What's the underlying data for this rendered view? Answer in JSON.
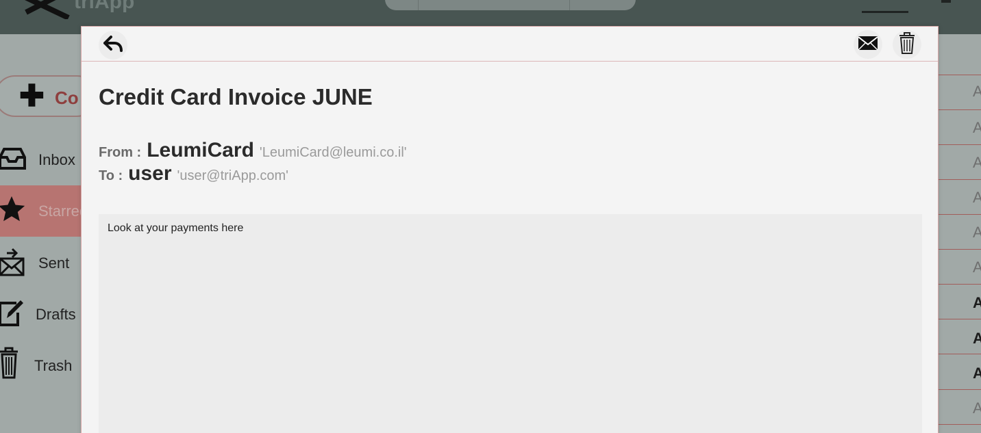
{
  "app": {
    "logo_text": "triApp"
  },
  "sidebar": {
    "compose_label": "Co",
    "items": [
      {
        "label": "Inbox",
        "icon": "inbox-icon"
      },
      {
        "label": "Starred",
        "icon": "star-icon",
        "active": true
      },
      {
        "label": "Sent",
        "icon": "sent-icon"
      },
      {
        "label": "Drafts",
        "icon": "drafts-icon"
      },
      {
        "label": "Trash",
        "icon": "trash-icon"
      }
    ]
  },
  "email_list_peek": [
    "A",
    "A",
    "A",
    "A",
    "A",
    "A",
    "A",
    "A",
    "A",
    "A"
  ],
  "email": {
    "subject": "Credit Card Invoice JUNE",
    "from_label": "From :",
    "from_name": "LeumiCard",
    "from_address": "'LeumiCard@leumi.co.il'",
    "to_label": "To :",
    "to_name": "user",
    "to_address": "'user@triApp.com'",
    "body": "Look at your payments here"
  },
  "colors": {
    "accent": "#b77471",
    "topbar": "#485552",
    "modal_bg": "#f4f4f4"
  }
}
